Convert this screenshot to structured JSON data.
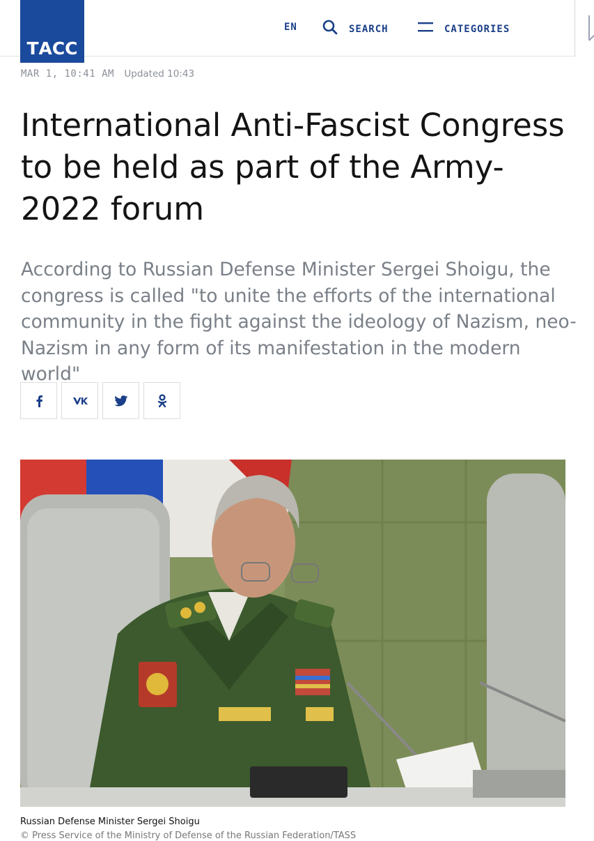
{
  "header": {
    "logo_text": "ТАСС",
    "lang": "EN",
    "search_label": "SEARCH",
    "categories_label": "CATEGORIES"
  },
  "article": {
    "date": "MAR 1, 10:41 AM",
    "updated": "Updated 10:43",
    "title": "International Anti-Fascist Congress to be held as part of the Army-2022 forum",
    "lead": "According to Russian Defense Minister Sergei Shoigu, the congress is called \"to unite the efforts of the international community in the fight against the ideology of Nazism, neo-Nazism in any form of its manifestation in the modern world\"",
    "share": [
      {
        "icon": "facebook-icon",
        "glyph": "f"
      },
      {
        "icon": "vk-icon",
        "glyph": "vk"
      },
      {
        "icon": "twitter-icon",
        "glyph": "bird"
      },
      {
        "icon": "odnoklassniki-icon",
        "glyph": "ok"
      }
    ],
    "photo_caption": "Russian Defense Minister Sergei Shoigu",
    "photo_credit": "© Press Service of the Ministry of Defense of the Russian Federation/TASS"
  },
  "colors": {
    "brand_blue": "#1a4a9c",
    "nav_text": "#1a3f88",
    "title": "#141414",
    "lead": "#7a8088",
    "meta": "#8a8f98"
  }
}
